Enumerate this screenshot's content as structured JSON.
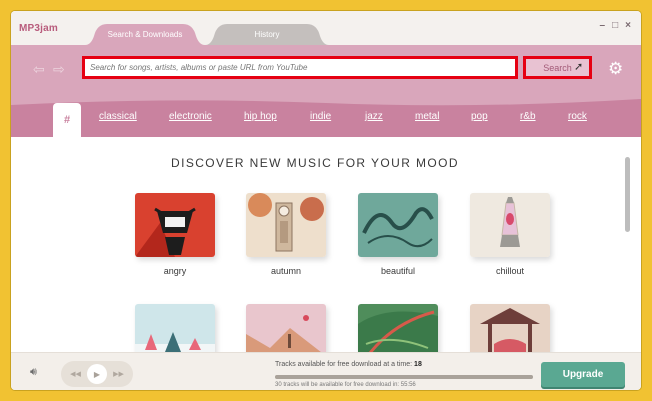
{
  "app": {
    "title": "MP3jam",
    "window_controls": [
      "–",
      "□",
      "×"
    ]
  },
  "tabs": [
    {
      "label": "Search & Downloads",
      "active": true
    },
    {
      "label": "History",
      "active": false
    }
  ],
  "search": {
    "placeholder": "Search for songs, artists, albums or paste URL from YouTube",
    "value": "",
    "button_label": "Search",
    "back_icon": "arrow-left-icon",
    "forward_icon": "arrow-right-icon",
    "settings_icon": "gear-icon"
  },
  "genres": {
    "active": "#",
    "items": [
      "#",
      "classical",
      "electronic",
      "hip hop",
      "indie",
      "jazz",
      "metal",
      "pop",
      "r&b",
      "rock"
    ]
  },
  "discover": {
    "heading": "DISCOVER NEW MUSIC FOR YOUR MOOD",
    "moods": [
      {
        "label": "angry"
      },
      {
        "label": "autumn"
      },
      {
        "label": "beautiful"
      },
      {
        "label": "chillout"
      },
      {
        "label": ""
      },
      {
        "label": ""
      },
      {
        "label": ""
      },
      {
        "label": ""
      }
    ]
  },
  "player": {
    "volume_icon": "speaker-icon",
    "prev_icon": "skip-back-icon",
    "play_icon": "play-icon",
    "next_icon": "skip-forward-icon",
    "tracks_text": "Tracks available for free download at a time:",
    "tracks_count": "18",
    "progress": 1.0,
    "timer_text": "30 tracks will be available for free download in: 55:56",
    "upgrade_label": "Upgrade"
  },
  "colors": {
    "brand_pink": "#c9829f",
    "search_band": "#d9a6bb",
    "highlight_red": "#e60012",
    "upgrade_green": "#5aa892",
    "frame_yellow": "#f1c232"
  }
}
